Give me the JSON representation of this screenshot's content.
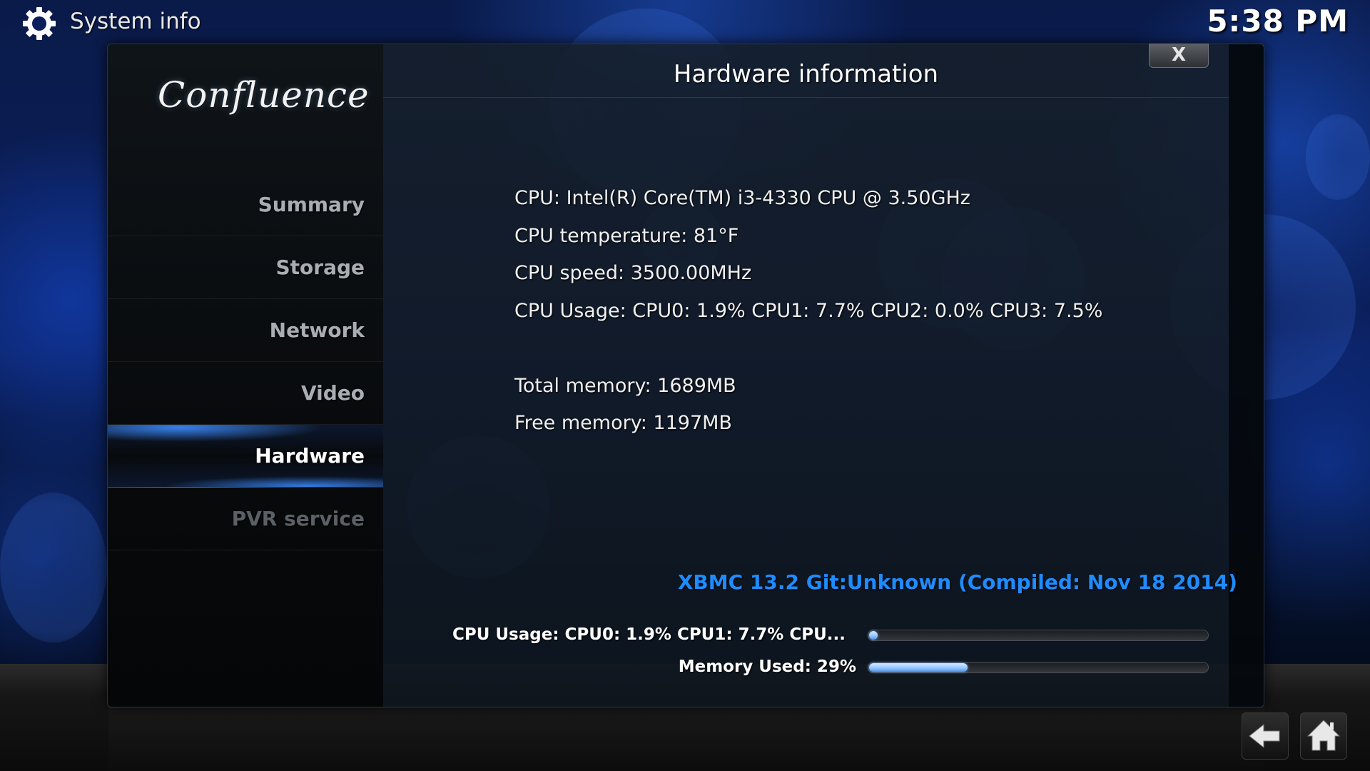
{
  "header": {
    "title": "System info",
    "clock": "5:38 PM",
    "icon": "gear-icon"
  },
  "logo": "Confluence",
  "sidebar": {
    "items": [
      {
        "label": "Summary",
        "state": "normal"
      },
      {
        "label": "Storage",
        "state": "normal"
      },
      {
        "label": "Network",
        "state": "normal"
      },
      {
        "label": "Video",
        "state": "normal"
      },
      {
        "label": "Hardware",
        "state": "selected"
      },
      {
        "label": "PVR service",
        "state": "disabled"
      }
    ]
  },
  "dialog": {
    "title": "Hardware information",
    "close_label": "X",
    "info": [
      "CPU: Intel(R) Core(TM) i3-4330 CPU @ 3.50GHz",
      "CPU temperature: 81°F",
      "CPU speed: 3500.00MHz",
      "CPU Usage: CPU0: 1.9% CPU1: 7.7% CPU2: 0.0% CPU3: 7.5%",
      "Total memory: 1689MB",
      "Free memory: 1197MB"
    ],
    "version": "XBMC 13.2 Git:Unknown (Compiled: Nov 18 2014)",
    "bars": [
      {
        "label": "CPU Usage: CPU0: 1.9% CPU1: 7.7% CPU...",
        "fraction": 0.02
      },
      {
        "label": "Memory Used: 29%",
        "fraction": 0.29
      }
    ]
  },
  "footer": {
    "back_icon": "back-arrow-icon",
    "home_icon": "home-icon"
  },
  "colors": {
    "accent": "#1e8cff",
    "selection_glow": "#3c8cff"
  }
}
